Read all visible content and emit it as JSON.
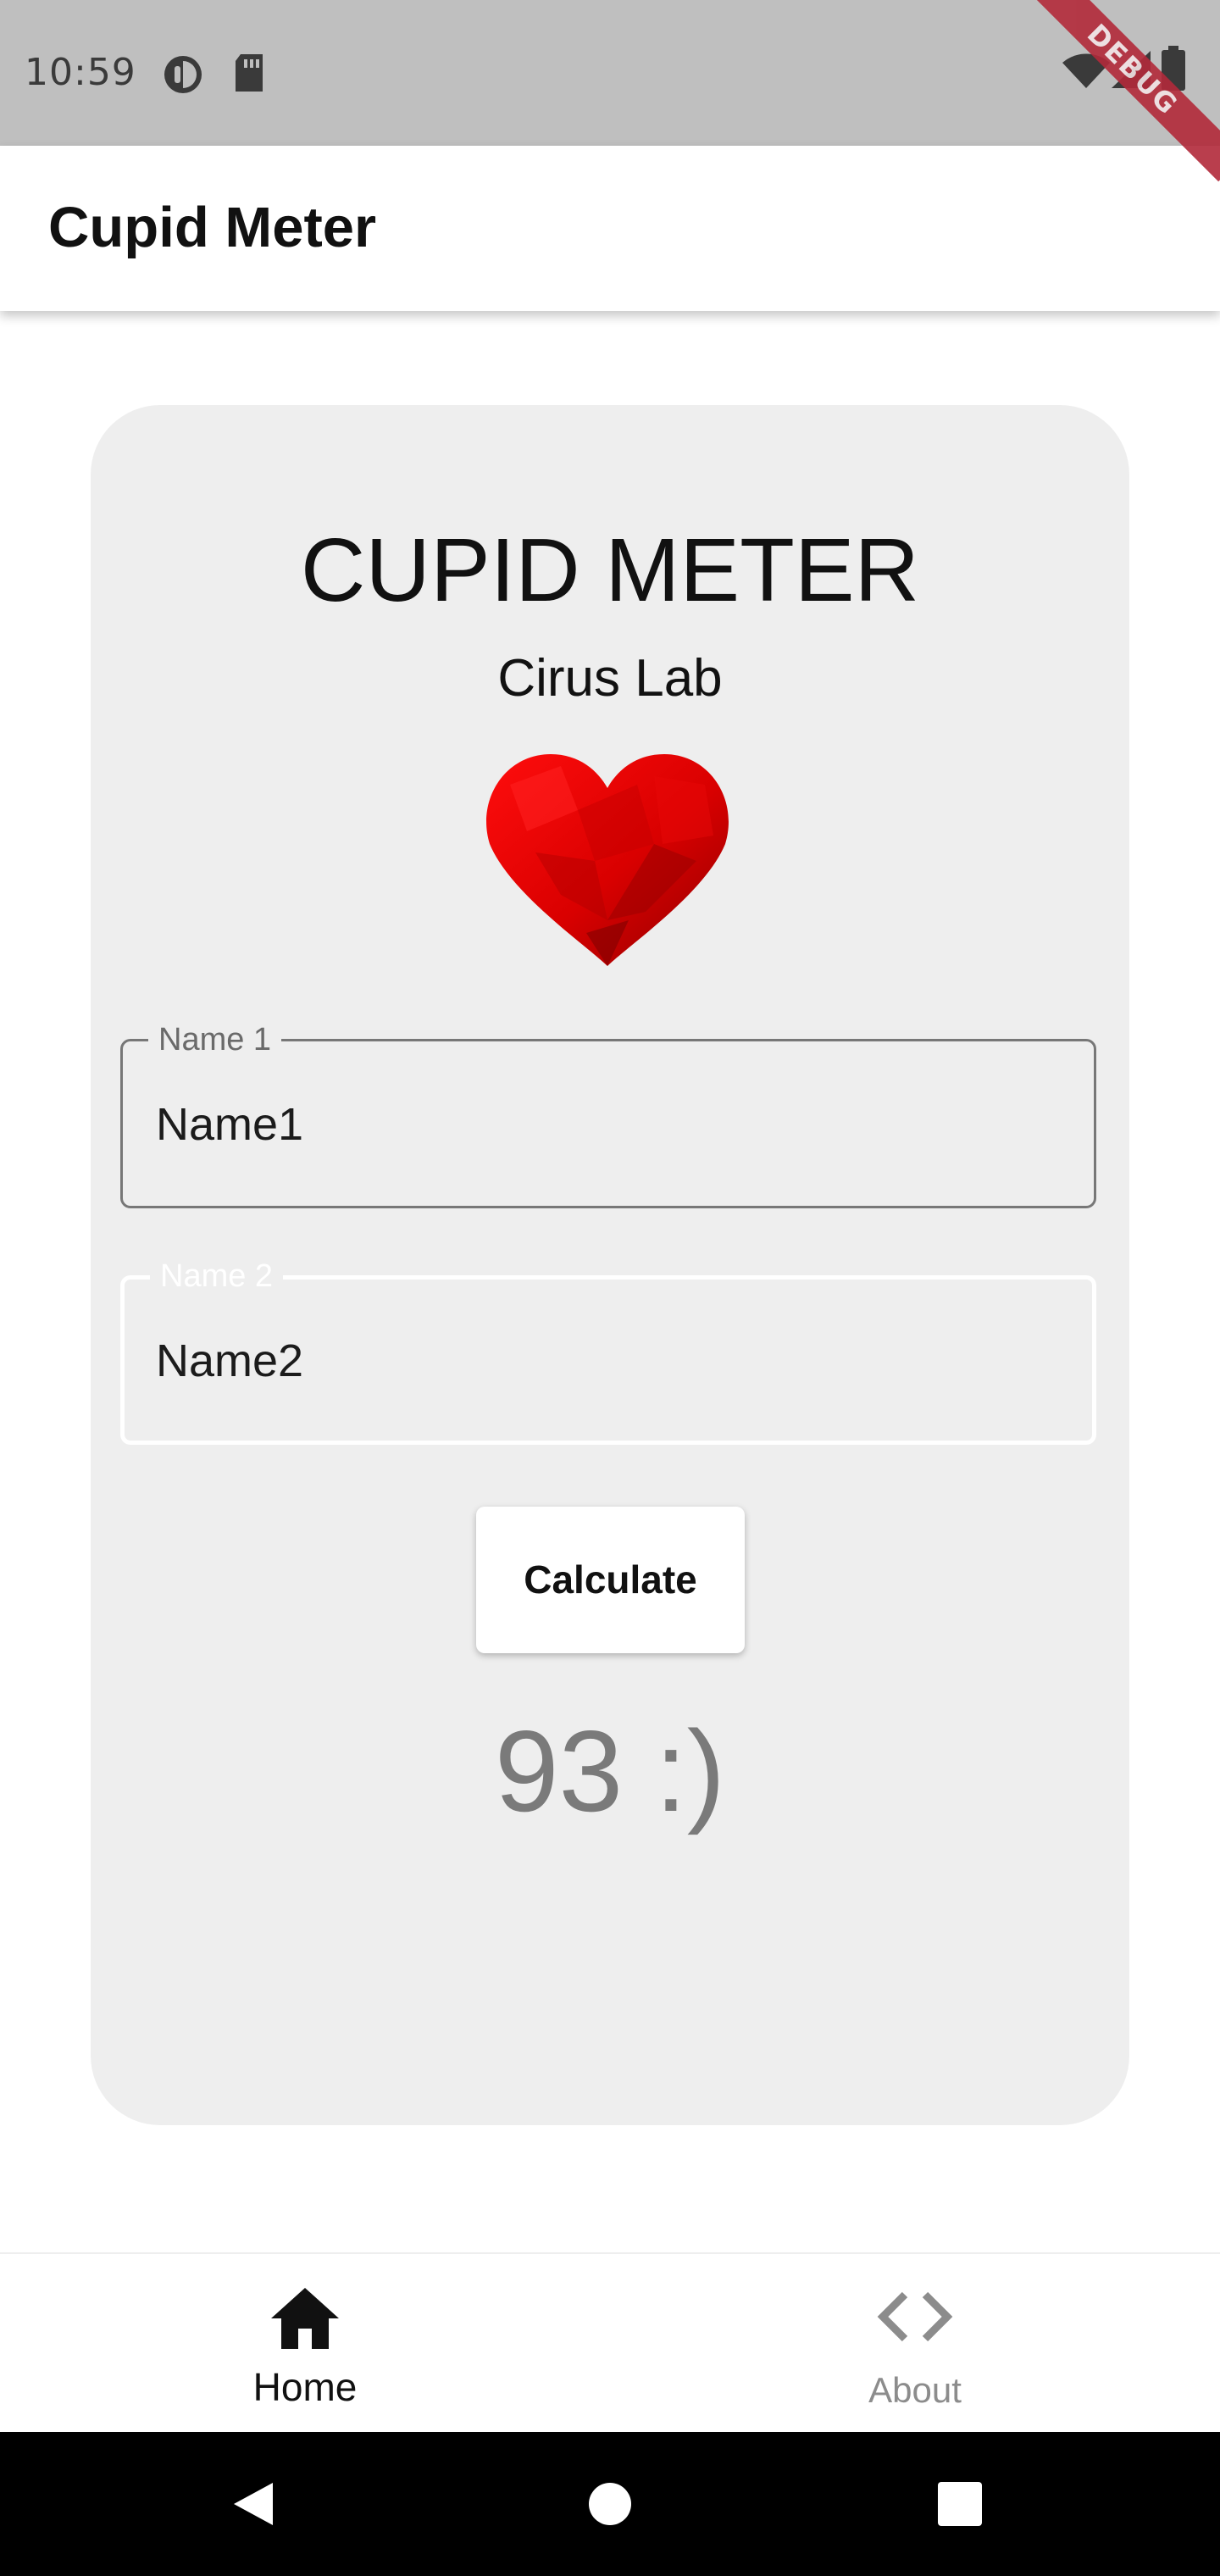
{
  "status_bar": {
    "time": "10:59",
    "icons": [
      "data-saver-icon",
      "sd-card-icon",
      "wifi-icon",
      "signal-icon",
      "battery-icon"
    ],
    "debug_banner": "DEBUG",
    "background_color": "#bfbfbf"
  },
  "app_bar": {
    "title": "Cupid Meter"
  },
  "card": {
    "title": "CUPID METER",
    "subtitle": "Cirus Lab",
    "image_icon": "heart-icon",
    "background_color": "#eeeeee",
    "fields": [
      {
        "label": "Name 1",
        "value": "Name1"
      },
      {
        "label": "Name 2",
        "value": "Name2"
      }
    ],
    "button_label": "Calculate",
    "result": "93 :)"
  },
  "bottom_nav": {
    "items": [
      {
        "label": "Home",
        "icon": "home-icon",
        "selected": true
      },
      {
        "label": "About",
        "icon": "code-icon",
        "selected": false
      }
    ]
  },
  "system_nav": {
    "icons": [
      "back-icon",
      "home-circle-icon",
      "recents-icon"
    ]
  },
  "colors": {
    "heart_red": "#e00000",
    "result_gray": "#7a7a7a",
    "focused_field_border": "#ffffff"
  }
}
